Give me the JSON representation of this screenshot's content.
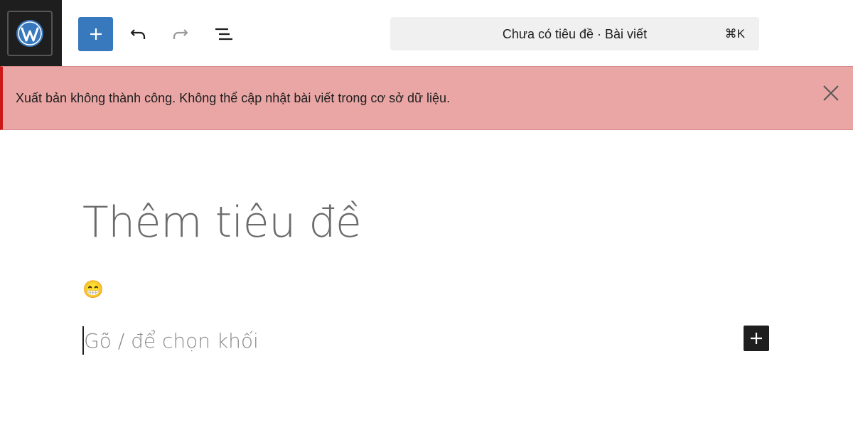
{
  "header": {
    "logo_icon": "wordpress-logo-icon",
    "add_block_icon": "plus-icon",
    "undo_icon": "undo-icon",
    "redo_icon": "redo-icon",
    "outline_icon": "list-view-icon",
    "command_bar": {
      "title": "Chưa có tiêu đề · Bài viết",
      "shortcut": "⌘K"
    }
  },
  "notice": {
    "message": "Xuất bản không thành công. Không thể cập nhật bài viết trong cơ sở dữ liệu.",
    "close_icon": "close-icon",
    "color": "#eaa6a5",
    "accent_color": "#cc1818"
  },
  "editor": {
    "title_placeholder": "Thêm tiêu đề",
    "emoji_content": "😁",
    "block_placeholder": "Gõ / để chọn khối",
    "inserter_icon": "plus-icon"
  },
  "colors": {
    "primary": "#3878bd",
    "dark": "#1e1e1e"
  }
}
